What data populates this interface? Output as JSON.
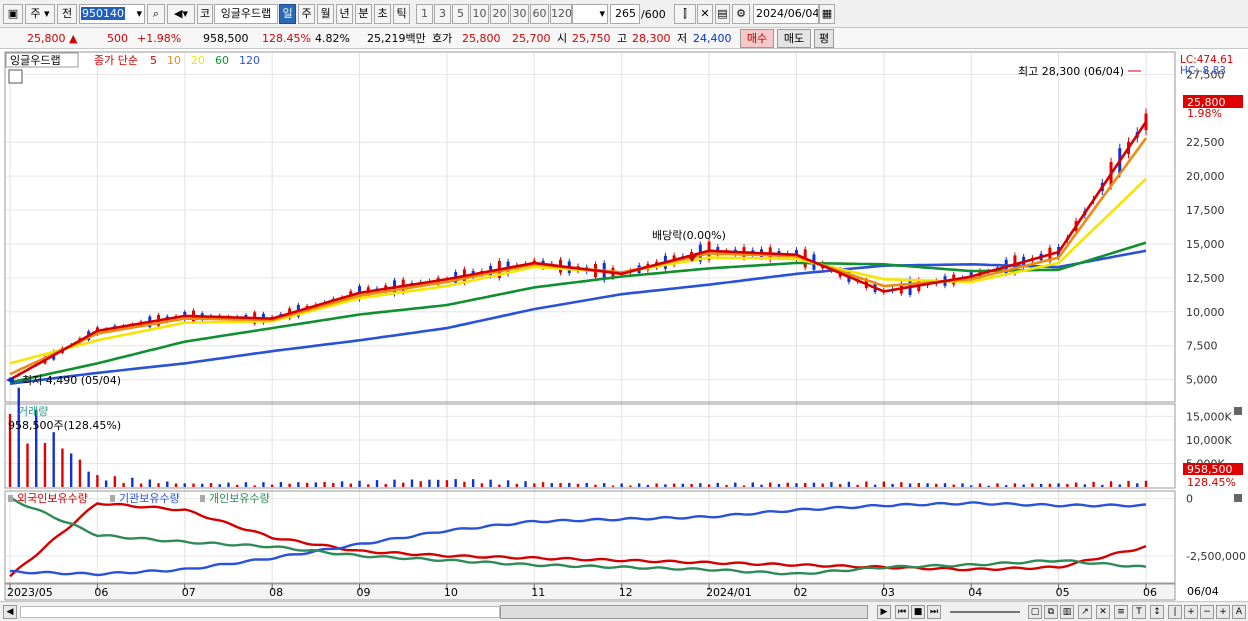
{
  "toolbar": {
    "stock_type": "주",
    "prev_label": "전",
    "code": "950140",
    "code_prefix": "코",
    "name": "잉글우드랩",
    "periods": [
      "일",
      "주",
      "월",
      "년",
      "분",
      "초",
      "틱"
    ],
    "active_period": "일",
    "minutes": [
      "1",
      "3",
      "5",
      "10",
      "20",
      "30",
      "60",
      "120"
    ],
    "count": "265",
    "count_max": "/600",
    "date": "2024/06/04"
  },
  "quote": {
    "price": "25,800",
    "change": "500",
    "change_pct": "+1.98%",
    "volume": "958,500",
    "volume_ratio": "128.45%",
    "turnover_pct": "4.82%",
    "amount": "25,219백만",
    "ask_label": "호가",
    "ask": "25,800",
    "bid": "25,700",
    "open_label": "시",
    "open": "25,750",
    "high_label": "고",
    "high": "28,300",
    "low_label": "저",
    "low": "24,400",
    "buy": "매수",
    "sell": "매도",
    "eval": "평"
  },
  "price_panel": {
    "stock_name": "잉글우드랩",
    "legend_label": "종가 단순",
    "ma_periods": [
      "5",
      "10",
      "20",
      "60",
      "120"
    ],
    "ma_colors": [
      "#d40000",
      "#ef8a10",
      "#f3e600",
      "#119030",
      "#2a52d8"
    ],
    "lc": "LC:474.61",
    "hc": "HC:-8.83",
    "high_annotation": "최고 28,300 (06/04)",
    "low_annotation": "최저 4,490 (05/04)",
    "dividend_annotation": "배당락(0.00%)",
    "current_price_tag": "25,800",
    "current_pct_tag": "1.98%",
    "y_ticks": [
      "27,500",
      "22,500",
      "20,000",
      "17,500",
      "15,000",
      "12,500",
      "10,000",
      "7,500",
      "5,000"
    ]
  },
  "volume_panel": {
    "title": "거래량",
    "current": "958,500주(128.45%)",
    "y_ticks": [
      "15,000K",
      "10,000K",
      "5,000K"
    ],
    "tag_value": "958,500",
    "tag_pct": "128.45%"
  },
  "holding_panel": {
    "legend": [
      "외국인보유수량",
      "기관보유수량",
      "개인보유수량"
    ],
    "legend_colors": [
      "#d40000",
      "#2a52d8",
      "#2e8b57"
    ],
    "y_ticks": [
      "0",
      "-2,500,000"
    ]
  },
  "x_axis": {
    "labels": [
      "2023/05",
      "06",
      "07",
      "08",
      "09",
      "10",
      "11",
      "12",
      "2024/01",
      "02",
      "03",
      "04",
      "05",
      "06"
    ],
    "right_label": "06/04"
  },
  "chart_data": {
    "type": "line",
    "x": [
      "2023/05",
      "2023/06",
      "2023/07",
      "2023/08",
      "2023/09",
      "2023/10",
      "2023/11",
      "2023/12",
      "2024/01",
      "2024/02",
      "2024/03",
      "2024/04",
      "2024/05",
      "2024/06"
    ],
    "series": [
      {
        "name": "5",
        "values": [
          5000,
          8600,
          9700,
          9500,
          11400,
          12400,
          13600,
          12800,
          14500,
          14200,
          11500,
          12600,
          14400,
          24000
        ]
      },
      {
        "name": "10",
        "values": [
          5400,
          8400,
          9500,
          9400,
          11200,
          12200,
          13500,
          12900,
          14300,
          14100,
          11900,
          12400,
          14000,
          22800
        ]
      },
      {
        "name": "20",
        "values": [
          6200,
          7900,
          9200,
          9300,
          11000,
          11900,
          13300,
          12900,
          14000,
          13900,
          12400,
          12200,
          13600,
          19800
        ]
      },
      {
        "name": "60",
        "values": [
          4800,
          6200,
          7800,
          8800,
          9800,
          10500,
          11800,
          12600,
          13200,
          13600,
          13500,
          13000,
          13100,
          15100
        ]
      },
      {
        "name": "120",
        "values": [
          4700,
          5500,
          6200,
          7100,
          7900,
          8800,
          10200,
          11300,
          12000,
          12800,
          13400,
          13500,
          13300,
          14500
        ]
      }
    ],
    "ylim": [
      3500,
      29000
    ],
    "volume": [
      15500,
      1800,
      600,
      700,
      900,
      1300,
      800,
      500,
      600,
      700,
      800,
      500,
      600,
      959
    ],
    "holdings": [
      {
        "name": "외국인보유수량",
        "values": [
          -3400000,
          -200000,
          -500000,
          -1700000,
          -2300000,
          -2500000,
          -2600000,
          -2700000,
          -2800000,
          -2900000,
          -3000000,
          -3100000,
          -3000000,
          -2100000
        ]
      },
      {
        "name": "기관보유수량",
        "values": [
          -3200000,
          -3300000,
          -3100000,
          -2600000,
          -2000000,
          -1400000,
          -1000000,
          -900000,
          -800000,
          -500000,
          -300000,
          -200000,
          -300000,
          -300000
        ]
      },
      {
        "name": "개인보유수량",
        "values": [
          0,
          -1600000,
          -1900000,
          -2100000,
          -2500000,
          -2700000,
          -2900000,
          -3000000,
          -3100000,
          -3300000,
          -3000000,
          -2900000,
          -2700000,
          -3000000
        ]
      }
    ]
  }
}
